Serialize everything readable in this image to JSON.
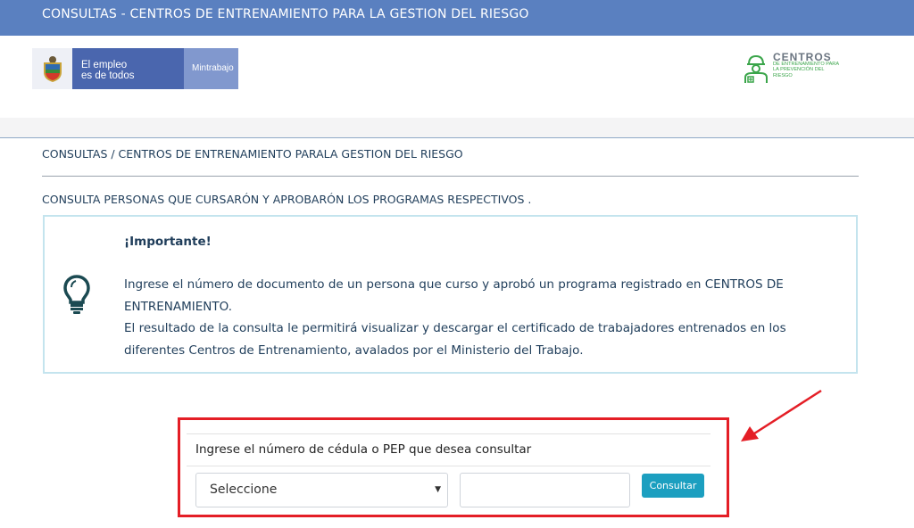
{
  "header": {
    "title": "CONSULTAS - CENTROS DE ENTRENAMIENTO PARA LA GESTION DEL RIESGO"
  },
  "gov_logo": {
    "line1": "El empleo",
    "line2": "es de todos",
    "ministry": "Mintrabajo"
  },
  "centros_logo": {
    "title": "CENTROS",
    "subtitle": "DE ENTRENAMIENTO PARA LA PREVENCIÓN DEL RIESGO"
  },
  "breadcrumb": "CONSULTAS / CENTROS DE ENTRENAMIENTO PARALA GESTION DEL RIESGO",
  "subtitle": "CONSULTA PERSONAS QUE CURSARÓN Y APROBARÓN LOS PROGRAMAS RESPECTIVOS .",
  "info": {
    "heading": "¡Importante!",
    "paragraph1": "Ingrese el número de documento de un persona que curso y aprobó un programa registrado en CENTROS DE ENTRENAMIENTO.",
    "paragraph2": "El resultado de la consulta le permitirá visualizar y descargar el certificado de trabajadores entrenados en los diferentes Centros de Entrenamiento, avalados por el Ministerio del Trabajo."
  },
  "form": {
    "label": "Ingrese el número de cédula o PEP que desea consultar",
    "select_value": "Seleccione",
    "input_value": "",
    "button_label": "Consultar"
  },
  "icons": {
    "info": "lightbulb-icon",
    "shield": "colombia-shield-icon",
    "worker": "worker-icon",
    "annotation": "red-arrow-icon"
  },
  "colors": {
    "header_bg": "#5a80c0",
    "button_bg": "#1c9fc0",
    "highlight": "#e41e26",
    "info_border": "#c4e4ee"
  }
}
